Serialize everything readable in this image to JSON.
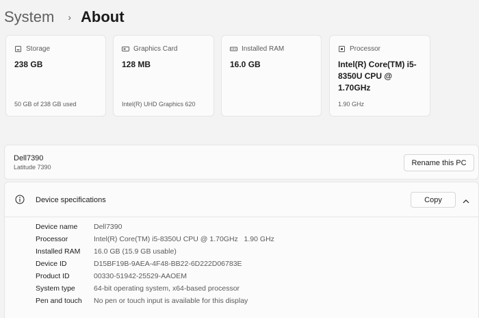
{
  "breadcrumb": {
    "parent": "System",
    "separator": "›",
    "current": "About"
  },
  "cards": [
    {
      "icon": "storage-icon",
      "label": "Storage",
      "value": "238 GB",
      "sub": "50 GB of 238 GB used"
    },
    {
      "icon": "graphics-card-icon",
      "label": "Graphics Card",
      "value": "128 MB",
      "sub": "Intel(R) UHD Graphics 620"
    },
    {
      "icon": "ram-icon",
      "label": "Installed RAM",
      "value": "16.0 GB",
      "sub": ""
    },
    {
      "icon": "processor-icon",
      "label": "Processor",
      "value": "Intel(R) Core(TM) i5-8350U CPU @ 1.70GHz",
      "sub": "1.90 GHz"
    }
  ],
  "pc": {
    "name": "Dell7390",
    "model": "Latitude 7390",
    "rename_label": "Rename this PC"
  },
  "specs": {
    "title": "Device specifications",
    "copy_label": "Copy",
    "rows": [
      {
        "label": "Device name",
        "value": "Dell7390"
      },
      {
        "label": "Processor",
        "value": "Intel(R) Core(TM) i5-8350U CPU @ 1.70GHz   1.90 GHz"
      },
      {
        "label": "Installed RAM",
        "value": "16.0 GB (15.9 GB usable)"
      },
      {
        "label": "Device ID",
        "value": "D15BF19B-9AEA-4F48-BB22-6D222D06783E"
      },
      {
        "label": "Product ID",
        "value": "00330-51942-25529-AAOEM"
      },
      {
        "label": "System type",
        "value": "64-bit operating system, x64-based processor"
      },
      {
        "label": "Pen and touch",
        "value": "No pen or touch input is available for this display"
      }
    ]
  },
  "colors": {
    "background": "#f3f3f3",
    "card": "#fbfbfb",
    "border": "#e5e5e5",
    "text_primary": "#1b1b1b",
    "text_secondary": "#5a5a5a"
  }
}
